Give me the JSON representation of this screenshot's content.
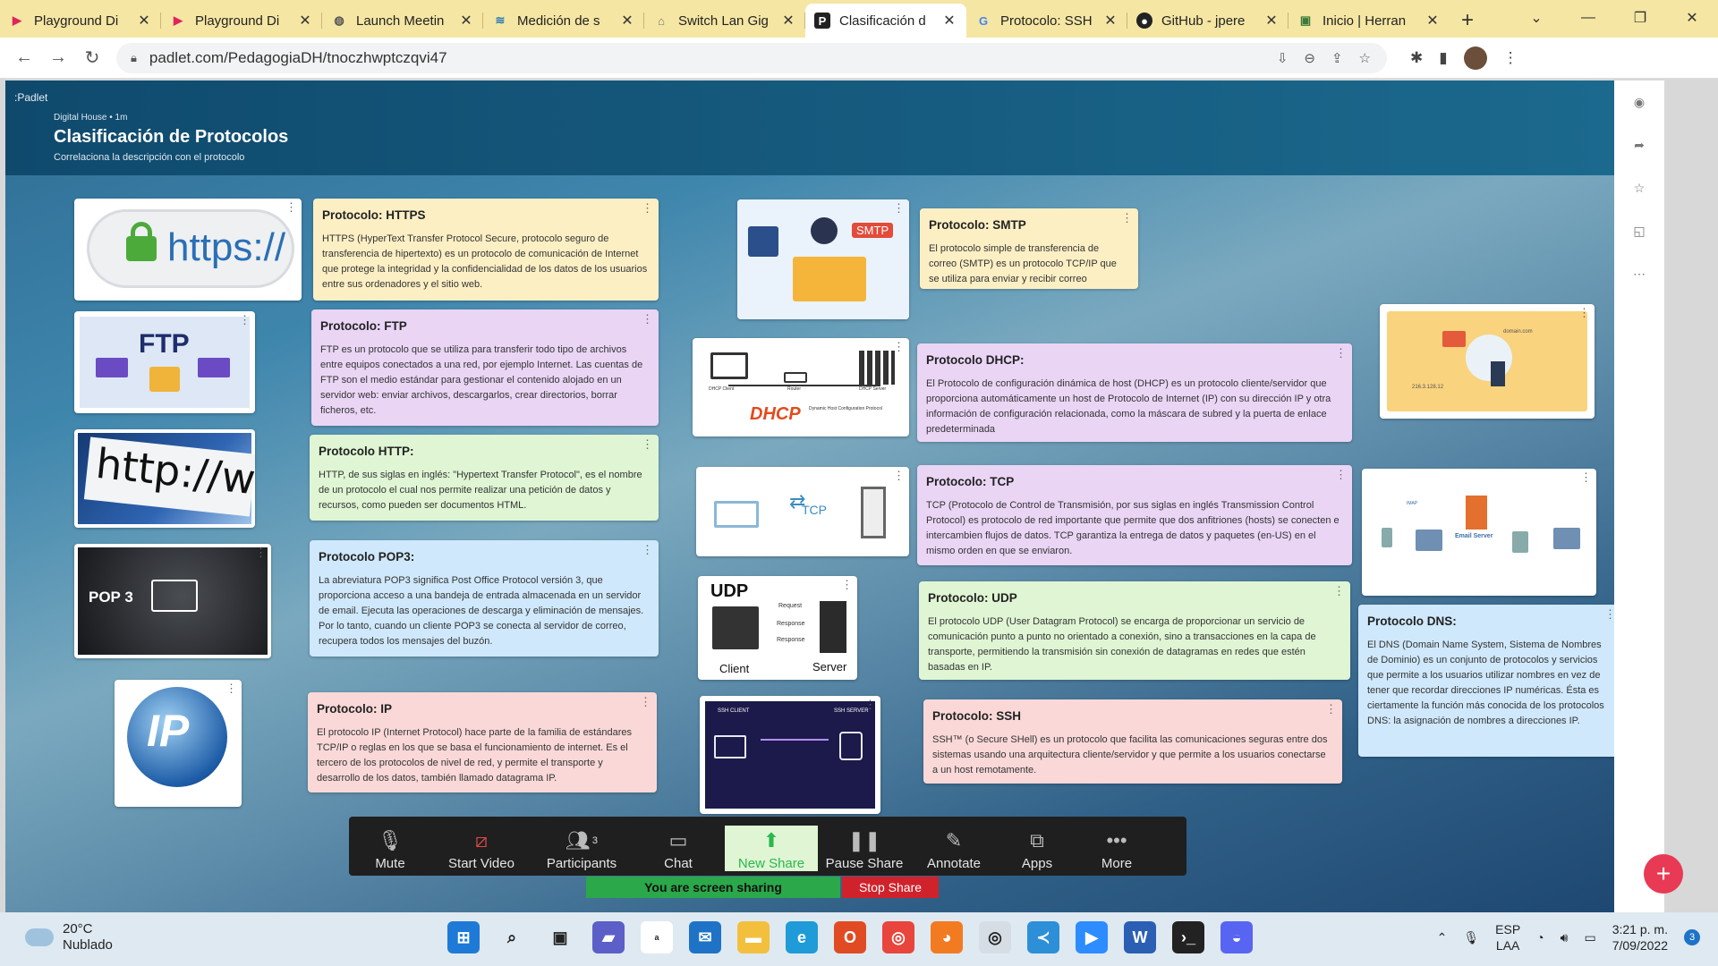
{
  "browser": {
    "tabs": [
      {
        "label": "Playground Di",
        "icon": "play-icon",
        "active": false
      },
      {
        "label": "Playground Di",
        "icon": "play-icon",
        "active": false
      },
      {
        "label": "Launch Meetin",
        "icon": "globe-icon",
        "active": false
      },
      {
        "label": "Medición de s",
        "icon": "speed-icon",
        "active": false
      },
      {
        "label": "Switch Lan Gig",
        "icon": "switch-icon",
        "active": false
      },
      {
        "label": "Clasificación d",
        "icon": "padlet-icon",
        "active": true
      },
      {
        "label": "Protocolo: SSH",
        "icon": "google-icon",
        "active": false
      },
      {
        "label": "GitHub - jpere",
        "icon": "github-icon",
        "active": false
      },
      {
        "label": "Inicio | Herran",
        "icon": "site-icon",
        "active": false
      }
    ],
    "url": "padlet.com/PedagogiaDH/tnoczhwptczqvi47"
  },
  "padlet": {
    "brand": ":Padlet",
    "meta": "Digital House • 1m",
    "title": "Clasificación de Protocolos",
    "subtitle": "Correlaciona la descripción con el protocolo",
    "images": {
      "https": "https://",
      "ftp": "FTP",
      "http": "http://ww",
      "pop3": "POP 3",
      "ip": "IP",
      "smtp": "SMTP",
      "dhcp": "DHCP",
      "dhcp_small": "Dynamic Host Configuration Protocol",
      "dhcp_client": "DHCP Client",
      "dhcp_server": "DHCP Server",
      "router": "Router",
      "tcp": "TCP",
      "udp": "UDP",
      "udp_request": "Request",
      "udp_response": "Response",
      "udp_response2": "Response",
      "udp_client": "Client",
      "udp_server": "Server",
      "ssh_client": "SSH CLIENT",
      "ssh_server": "SSH SERVER",
      "domain": "domain.com",
      "ipaddr": "216.3.128.12",
      "email_server": "Email Server",
      "imap": "IMAP"
    },
    "cards": {
      "https": {
        "title": "Protocolo: HTTPS",
        "body": "HTTPS (HyperText Transfer Protocol Secure, protocolo seguro de transferencia de hipertexto) es un protocolo de comunicación de Internet que protege la integridad y la confidencialidad de los datos de los usuarios entre sus ordenadores y el sitio web."
      },
      "ftp": {
        "title": "Protocolo: FTP",
        "body": "FTP es un protocolo que se utiliza para transferir todo tipo de archivos entre equipos conectados a una red, por ejemplo Internet. Las cuentas de FTP son el medio estándar para gestionar el contenido alojado en un servidor web: enviar archivos, descargarlos, crear directorios, borrar ficheros, etc."
      },
      "http": {
        "title": "Protocolo HTTP:",
        "body": "HTTP, de sus siglas en inglés: \"Hypertext Transfer Protocol\", es el nombre de un protocolo el cual nos permite realizar una petición de datos y recursos, como pueden ser documentos HTML."
      },
      "pop3": {
        "title": "Protocolo POP3:",
        "body": "La abreviatura POP3 significa Post Office Protocol versión 3, que proporciona acceso a una bandeja de entrada almacenada en un servidor de email. Ejecuta las operaciones de descarga y eliminación de mensajes. Por lo tanto, cuando un cliente POP3 se conecta al servidor de correo, recupera todos los mensajes del buzón."
      },
      "ip": {
        "title": "Protocolo: IP",
        "body": "El protocolo IP (Internet Protocol) hace parte de la familia de estándares TCP/IP o reglas en los que se basa el funcionamiento de internet. Es el tercero de los protocolos de nivel de red, y permite el transporte y desarrollo de los datos, también llamado datagrama IP."
      },
      "smtp": {
        "title": "Protocolo: SMTP",
        "body": "El protocolo simple de transferencia de correo (SMTP) es un protocolo TCP/IP que se utiliza para enviar y recibir correo electrónico."
      },
      "dhcp": {
        "title": "Protocolo DHCP:",
        "body": "El Protocolo de configuración dinámica de host (DHCP) es un protocolo cliente/servidor que proporciona automáticamente un host de Protocolo de Internet (IP) con su dirección IP y otra información de configuración relacionada, como la máscara de subred y la puerta de enlace predeterminada"
      },
      "tcp": {
        "title": "Protocolo: TCP",
        "body": "TCP (Protocolo de Control de Transmisión, por sus siglas en inglés Transmission Control Protocol) es protocolo de red importante que permite que dos anfitriones (hosts) se conecten e intercambien flujos de datos. TCP garantiza la entrega de datos y paquetes (en-US) en el mismo orden en que se enviaron."
      },
      "udp": {
        "title": "Protocolo: UDP",
        "body": "El protocolo UDP (User Datagram Protocol) se encarga de proporcionar un servicio de comunicación punto a punto no orientado a conexión, sino a transacciones en la capa de transporte, permitiendo la transmisión sin conexión de datagramas en redes que estén basadas en IP."
      },
      "ssh": {
        "title": "Protocolo: SSH",
        "body": "SSH™ (o Secure SHell) es un protocolo que facilita las comunicaciones seguras entre dos sistemas usando una arquitectura cliente/servidor y que permite a los usuarios conectarse a un host remotamente."
      },
      "dns": {
        "title": "Protocolo DNS:",
        "body": "El DNS (Domain Name System, Sistema de Nombres de Dominio) es un conjunto de protocolos y servicios que permite a los usuarios utilizar nombres en vez de tener que recordar direcciones IP numéricas. Ésta es ciertamente la función más conocida de los protocolos DNS: la asignación de nombres a direcciones IP."
      }
    }
  },
  "zoom": {
    "buttons": [
      {
        "label": "Mute",
        "icon": "microphone-icon"
      },
      {
        "label": "Start Video",
        "icon": "video-off-icon"
      },
      {
        "label": "Participants",
        "icon": "participants-icon",
        "count": "3"
      },
      {
        "label": "Chat",
        "icon": "chat-icon"
      },
      {
        "label": "New Share",
        "icon": "share-up-icon"
      },
      {
        "label": "Pause Share",
        "icon": "pause-icon"
      },
      {
        "label": "Annotate",
        "icon": "pencil-icon"
      },
      {
        "label": "Apps",
        "icon": "apps-icon"
      },
      {
        "label": "More",
        "icon": "more-icon"
      }
    ],
    "sharing_text": "You are screen sharing",
    "stop_share": "Stop Share"
  },
  "taskbar": {
    "temp": "20°C",
    "weather": "Nublado",
    "lang1": "ESP",
    "lang2": "LAA",
    "time": "3:21 p. m.",
    "date": "7/09/2022",
    "notif": "3"
  },
  "colors": {
    "tab_strip": "#f5e6a3",
    "zoom_green": "#2ab84f",
    "stop_red": "#d0222b",
    "fab": "#e83a55"
  }
}
